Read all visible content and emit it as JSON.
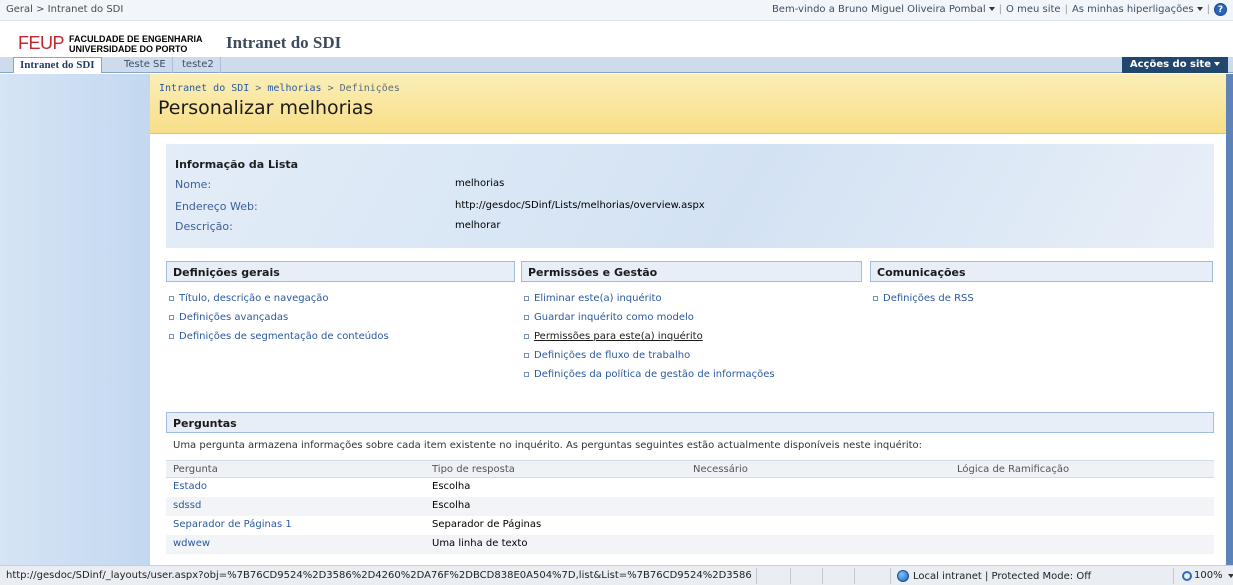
{
  "topbar": {
    "breadcrumb": "Geral > Intranet do SDI",
    "welcome": "Bem-vindo a Bruno Miguel Oliveira Pombal",
    "my_site": "O meu site",
    "my_links": "As minhas hiperligações"
  },
  "header": {
    "logo_feup": "FEUP",
    "logo_line1": "FACULDADE DE ENGENHARIA",
    "logo_line2": "UNIVERSIDADE DO PORTO",
    "site_title": "Intranet do SDI"
  },
  "tabs": [
    {
      "label": "Intranet do SDI"
    },
    {
      "label": "Teste SE"
    },
    {
      "label": "teste2"
    }
  ],
  "site_actions": "Acções do site",
  "page": {
    "crumb_root": "Intranet do SDI",
    "crumb_list": "melhorias",
    "crumb_current": "Definições",
    "title": "Personalizar melhorias"
  },
  "list_info": {
    "heading": "Informação da Lista",
    "name_label": "Nome:",
    "name_value": "melhorias",
    "url_label": "Endereço Web:",
    "url_value": "http://gesdoc/SDinf/Lists/melhorias/overview.aspx",
    "desc_label": "Descrição:",
    "desc_value": "melhorar"
  },
  "sections": {
    "general": {
      "heading": "Definições gerais",
      "links": [
        "Título, descrição e navegação",
        "Definições avançadas",
        "Definições de segmentação de conteúdos"
      ]
    },
    "permissions": {
      "heading": "Permissões e Gestão",
      "links": [
        "Eliminar este(a) inquérito",
        "Guardar inquérito como modelo",
        "Permissões para este(a) inquérito",
        "Definições de fluxo de trabalho",
        "Definições da política de gestão de informações"
      ]
    },
    "communications": {
      "heading": "Comunicações",
      "links": [
        "Definições de RSS"
      ]
    }
  },
  "questions": {
    "heading": "Perguntas",
    "description": "Uma pergunta armazena informações sobre cada item existente no inquérito. As perguntas seguintes estão actualmente disponíveis neste inquérito:",
    "columns": [
      "Pergunta",
      "Tipo de resposta",
      "Necessário",
      "Lógica de Ramificação"
    ],
    "rows": [
      {
        "name": "Estado",
        "type": "Escolha"
      },
      {
        "name": "sdssd",
        "type": "Escolha"
      },
      {
        "name": "Separador de Páginas 1",
        "type": "Separador de Páginas"
      },
      {
        "name": "wdwew",
        "type": "Uma linha de texto"
      }
    ]
  },
  "statusbar": {
    "url": "http://gesdoc/SDinf/_layouts/user.aspx?obj=%7B76CD9524%2D3586%2D4260%2DA76F%2DBCD838E0A504%7D,list&List=%7B76CD9524%2D3586",
    "zone": "Local intranet | Protected Mode: Off",
    "zoom": "100%"
  }
}
